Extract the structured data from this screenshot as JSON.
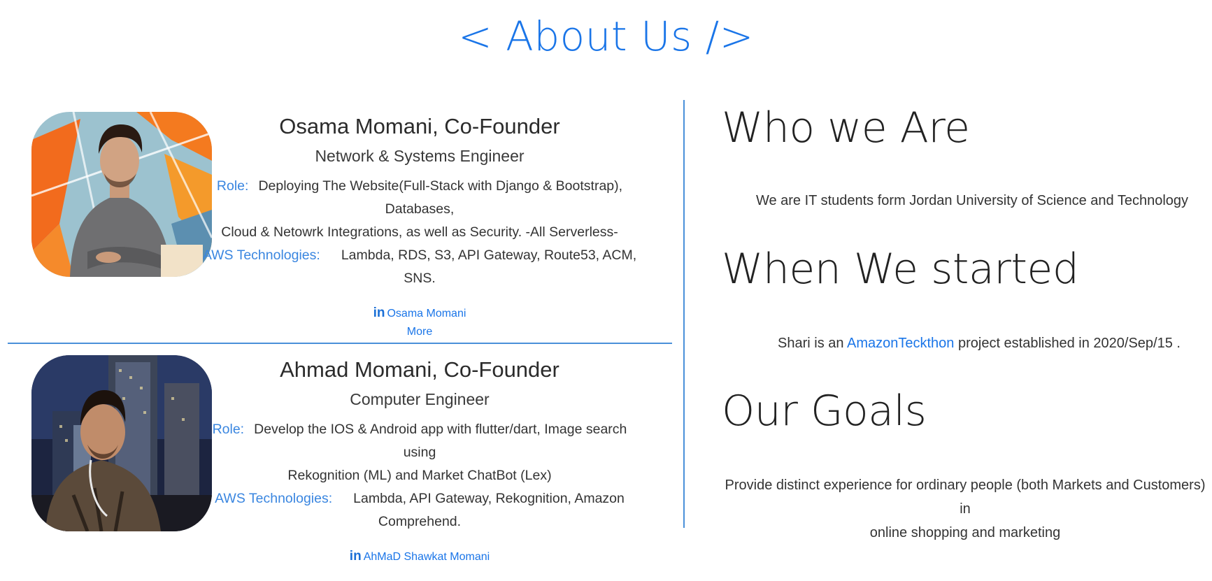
{
  "page": {
    "title": "< About Us />"
  },
  "members": [
    {
      "name": "Osama Momani, Co-Founder",
      "title": "Network & Systems Engineer",
      "role_label": "Role:",
      "role_text_1": "Deploying The Website(Full-Stack with Django & Bootstrap),",
      "role_text_2": "Databases,",
      "role_text_3": "Cloud & Netowrk Integrations, as well as Security. -All Serverless-",
      "aws_label": "AWS Technologies:",
      "aws_text": "Lambda, RDS, S3, API Gateway, Route53, ACM, SNS.",
      "linkedin_icon": "in",
      "linkedin_text": "Osama Momani",
      "more_text": "More"
    },
    {
      "name": "Ahmad Momani, Co-Founder",
      "title": "Computer Engineer",
      "role_label": "Role:",
      "role_text_1": "Develop the IOS & Android app with flutter/dart, Image search using",
      "role_text_2": "Rekognition (ML) and Market ChatBot (Lex)",
      "aws_label": "AWS Technologies:",
      "aws_text_1": "Lambda, API Gateway, Rekognition, Amazon",
      "aws_text_2": "Comprehend.",
      "linkedin_icon": "in",
      "linkedin_text": "AhMaD Shawkat Momani"
    }
  ],
  "about": {
    "who_heading": "Who we Are",
    "who_text": "We are IT students form Jordan University of Science and Technology",
    "when_heading": "When We started",
    "when_text_before": "Shari is an",
    "when_link": "AmazonTeckthon",
    "when_text_after": "project established in 2020/Sep/15 .",
    "goals_heading": "Our Goals",
    "goals_text_1": "Provide distinct experience for ordinary people (both Markets and Customers) in",
    "goals_text_2": "online shopping and marketing"
  },
  "colors": {
    "accent": "#1a75e8",
    "divider": "#4a90d9",
    "text": "#333333"
  },
  "icons": {
    "linkedin": "linkedin-icon"
  }
}
